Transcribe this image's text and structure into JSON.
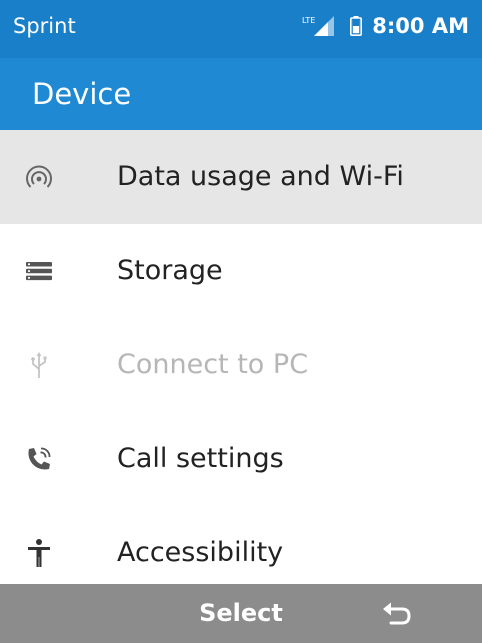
{
  "status_bar": {
    "carrier": "Sprint",
    "network_label": "LTE",
    "time": "8:00 AM",
    "icons": [
      "lte-signal-icon",
      "battery-icon"
    ],
    "background": "#1a7fc9"
  },
  "app_bar": {
    "title": "Device",
    "background": "#1f8ad3"
  },
  "menu": {
    "items": [
      {
        "label": "Data usage and Wi-Fi",
        "icon": "wifi-data-icon",
        "selected": true,
        "enabled": true
      },
      {
        "label": "Storage",
        "icon": "storage-icon",
        "selected": false,
        "enabled": true
      },
      {
        "label": "Connect to PC",
        "icon": "usb-icon",
        "selected": false,
        "enabled": false
      },
      {
        "label": "Call settings",
        "icon": "phone-call-icon",
        "selected": false,
        "enabled": true
      },
      {
        "label": "Accessibility",
        "icon": "accessibility-icon",
        "selected": false,
        "enabled": true
      }
    ],
    "selected_background": "#e6e6e6"
  },
  "softkeys": {
    "center_label": "Select",
    "right_icon": "back-icon",
    "background": "#8c8c8c"
  }
}
